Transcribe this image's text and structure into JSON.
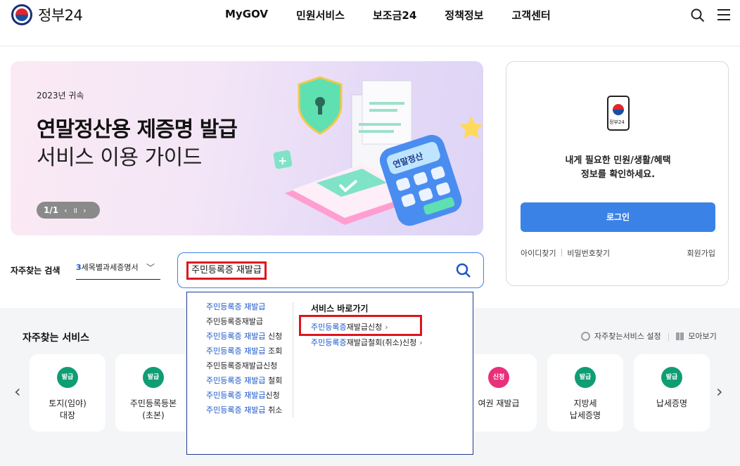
{
  "header": {
    "logo_text": "정부24",
    "nav": [
      "MyGOV",
      "민원서비스",
      "보조금24",
      "정책정보",
      "고객센터"
    ]
  },
  "banner": {
    "year_label": "2023년 귀속",
    "title": "연말정산용 제증명 발급",
    "subtitle": "서비스 이용 가이드",
    "pager": "1/1",
    "art_label": "연말정산"
  },
  "login": {
    "phone_label": "정부24",
    "message_line1": "내게 필요한 민원/생활/혜택",
    "message_line2": "정보를 확인하세요.",
    "button": "로그인",
    "find_id": "아이디찾기",
    "find_pw": "비밀번호찾기",
    "join": "회원가입"
  },
  "search": {
    "frequent_label": "자주찾는 검색",
    "frequent_num": "3",
    "frequent_text": "세목별과세증명서",
    "query": "주민등록증 재발급"
  },
  "dropdown": {
    "suggestions": [
      {
        "hl": "주민등록증 재발급",
        "rest": ""
      },
      {
        "hl": "",
        "rest": "주민등록증재발급"
      },
      {
        "hl": "주민등록증 재발급",
        "rest": " 신청"
      },
      {
        "hl": "주민등록증 재발급",
        "rest": " 조회"
      },
      {
        "hl": "",
        "rest": "주민등록증재발급신청"
      },
      {
        "hl": "주민등록증 재발급",
        "rest": " 철회"
      },
      {
        "hl": "주민등록증 재발급",
        "rest": "신청"
      },
      {
        "hl": "주민등록증 재발급",
        "rest": " 취소"
      }
    ],
    "shortcut_title": "서비스 바로가기",
    "shortcut1_hl": "주민등록증",
    "shortcut1_rest": "재발급신청",
    "shortcut2_hl": "주민등록증",
    "shortcut2_rest": "재발급철회(취소)신청"
  },
  "services": {
    "title": "자주찾는 서비스",
    "settings": "자주찾는서비스 설정",
    "view_all": "모아보기",
    "cards": [
      {
        "badge": "발급",
        "line1": "토지(임야)",
        "line2": "대장",
        "color": "#0f9e73"
      },
      {
        "badge": "발급",
        "line1": "주민등록등본",
        "line2": "(초본)",
        "color": "#0f9e73"
      },
      {
        "badge": "신청",
        "line1": "여권 재발급",
        "line2": "",
        "color": "#e8317a"
      },
      {
        "badge": "발급",
        "line1": "지방세",
        "line2": "납세증명",
        "color": "#0f9e73"
      },
      {
        "badge": "발급",
        "line1": "납세증명",
        "line2": "",
        "color": "#0f9e73"
      }
    ]
  },
  "colors": {
    "primary": "#3b82e6",
    "highlight_red": "#e0141d",
    "link_blue": "#1a56c8"
  }
}
